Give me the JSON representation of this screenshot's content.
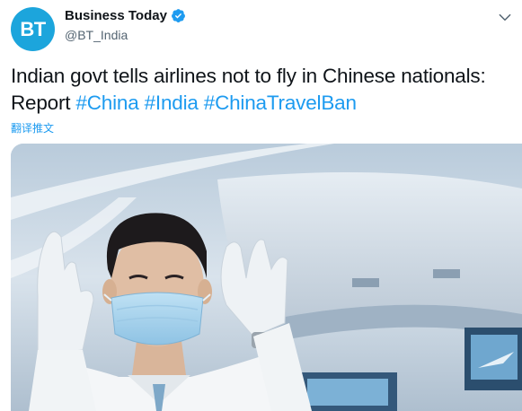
{
  "account": {
    "avatar_text": "BT",
    "display_name": "Business Today",
    "handle": "@BT_India",
    "verified": true
  },
  "tweet": {
    "text_line1": "Indian govt tells airlines not to fly in Chinese nationals:",
    "text_line2_prefix": "Report",
    "hashtags": [
      "#China",
      "#India",
      "#ChinaTravelBan"
    ],
    "translate_label": "翻译推文"
  },
  "media": {
    "description_icon": "photo"
  },
  "colors": {
    "accent": "#1d9bf0",
    "avatar_bg": "#1ca5dc",
    "text": "#0f1419",
    "muted": "#536471"
  }
}
